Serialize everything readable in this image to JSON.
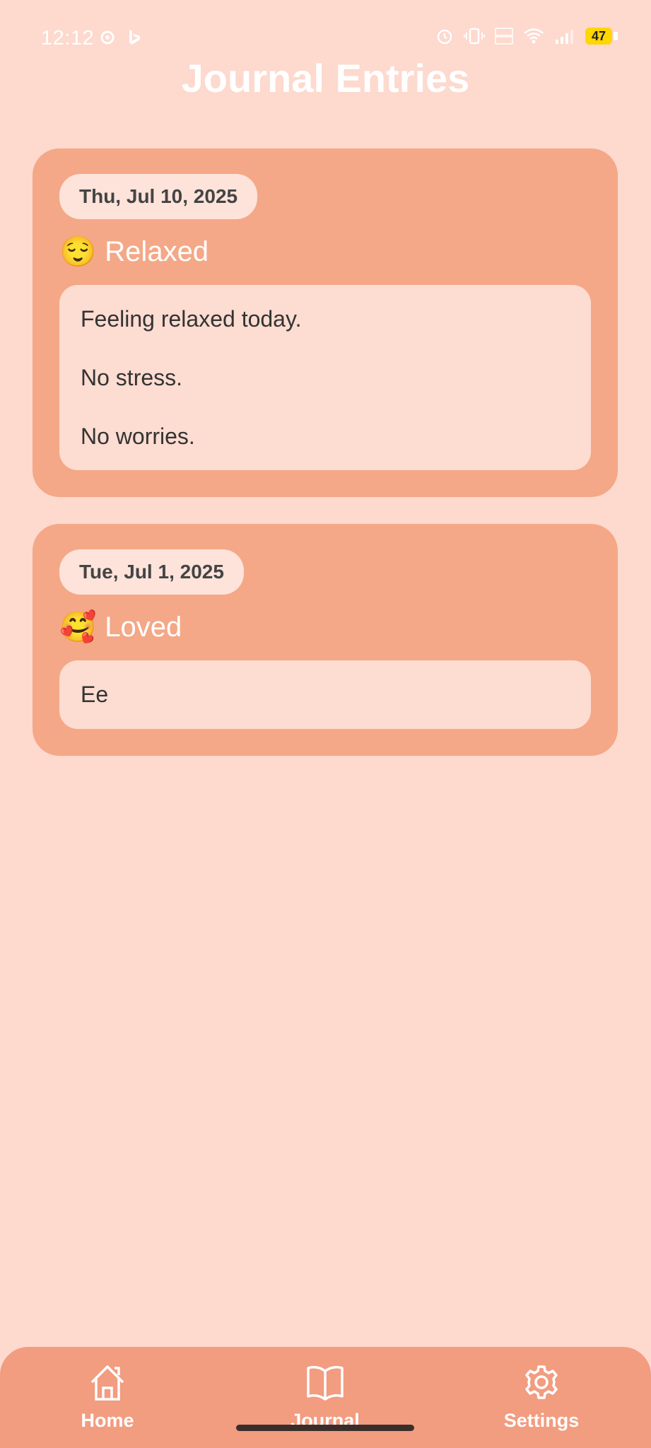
{
  "status": {
    "time": "12:12",
    "battery": "47"
  },
  "page_title": "Journal Entries",
  "entries": [
    {
      "date": "Thu, Jul 10, 2025",
      "mood_emoji": "😌",
      "mood": "Relaxed",
      "lines": [
        "Feeling relaxed today.",
        "No stress.",
        "No worries."
      ]
    },
    {
      "date": "Tue, Jul 1, 2025",
      "mood_emoji": "🥰",
      "mood": "Loved",
      "lines": [
        "Ee"
      ]
    }
  ],
  "nav": {
    "items": [
      {
        "label": "Home",
        "icon": "home-icon"
      },
      {
        "label": "Journal",
        "icon": "book-icon"
      },
      {
        "label": "Settings",
        "icon": "gear-icon"
      }
    ],
    "active": "Journal"
  },
  "colors": {
    "background": "#FDD9CE",
    "card": "#F4A887",
    "nav": "#F29C80",
    "note": "#FDDCD1"
  }
}
